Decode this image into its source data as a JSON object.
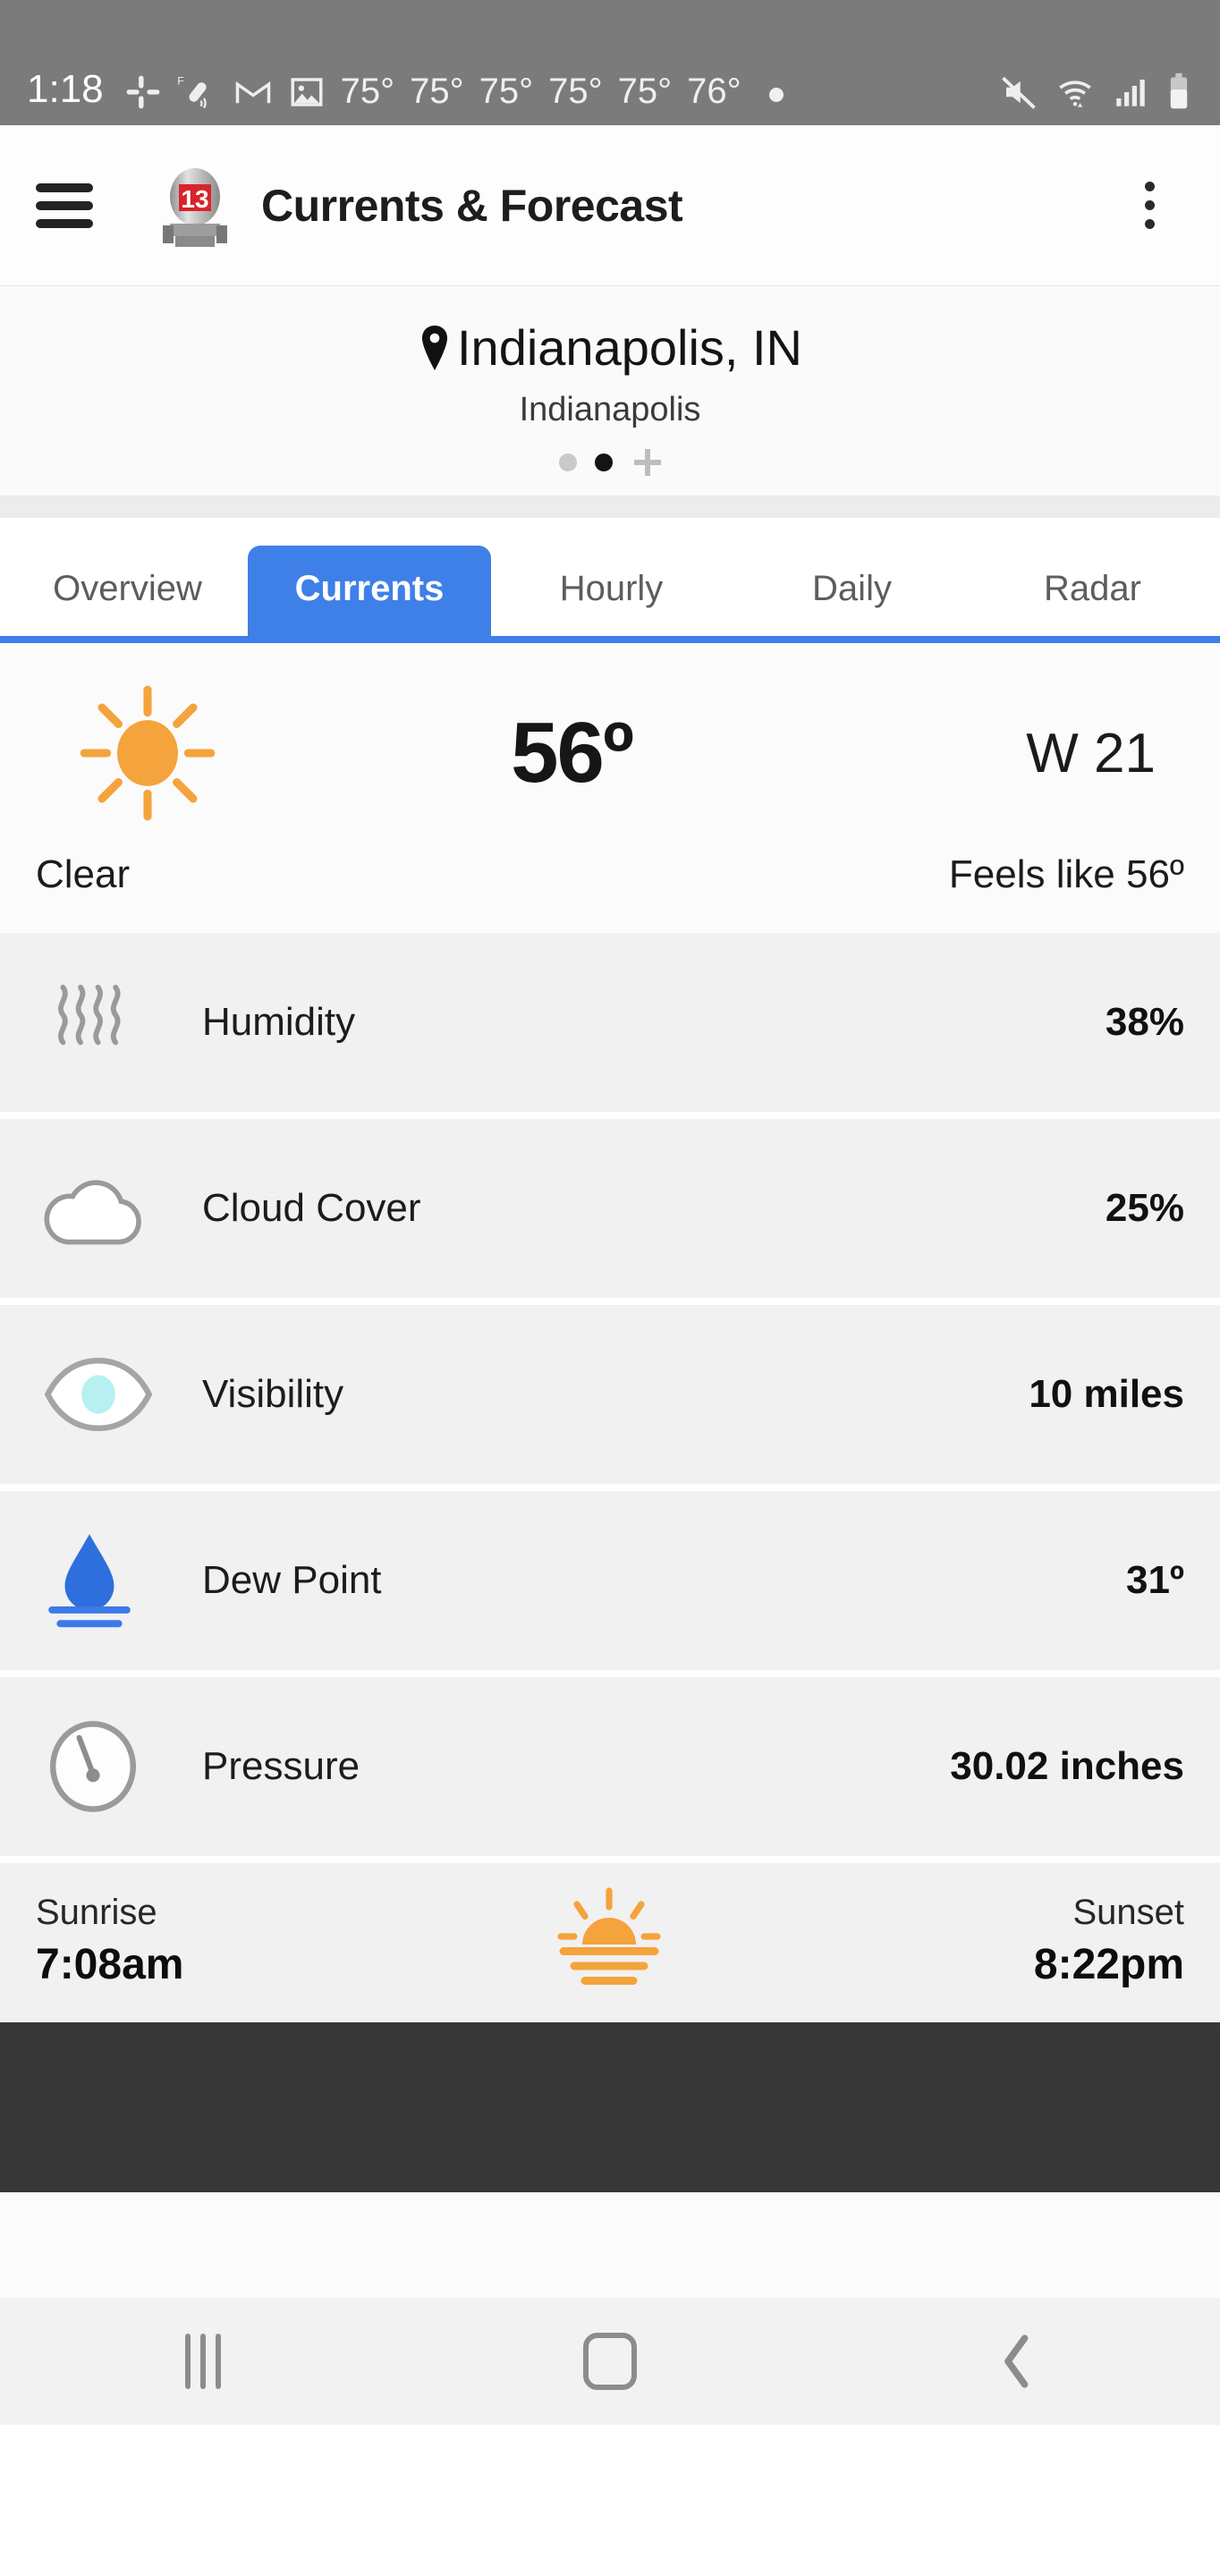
{
  "statusbar": {
    "time": "1:18",
    "icons_left": [
      "slack-icon",
      "sensor-cast-icon",
      "gmail-icon",
      "photo-icon"
    ],
    "temperatures": [
      "75°",
      "75°",
      "75°",
      "75°",
      "75°",
      "76°"
    ],
    "icons_right": [
      "mute-icon",
      "wifi-icon",
      "signal-icon",
      "battery-icon"
    ],
    "background": "#7b7b7b"
  },
  "appbar": {
    "menu_icon": "hamburger-icon",
    "logo": "channel-13-logo",
    "logo_number": "13",
    "title": "Currents & Forecast",
    "overflow_icon": "overflow-menu-icon"
  },
  "location": {
    "pin_icon": "location-pin-icon",
    "name": "Indianapolis, IN",
    "sub": "Indianapolis",
    "page_dots": [
      {
        "active": false
      },
      {
        "active": true
      }
    ],
    "add_label": "add-location-icon"
  },
  "tabs": [
    {
      "label": "Overview",
      "active": false
    },
    {
      "label": "Currents",
      "active": true
    },
    {
      "label": "Hourly",
      "active": false
    },
    {
      "label": "Daily",
      "active": false
    },
    {
      "label": "Radar",
      "active": false
    }
  ],
  "current": {
    "weather_icon": "sun-icon",
    "temperature": "56º",
    "wind": "W 21",
    "condition": "Clear",
    "feels_like": "Feels like 56º"
  },
  "details": [
    {
      "icon": "humidity-waves-icon",
      "label": "Humidity",
      "value": "38%"
    },
    {
      "icon": "cloud-icon",
      "label": "Cloud Cover",
      "value": "25%"
    },
    {
      "icon": "eye-icon",
      "label": "Visibility",
      "value": "10 miles"
    },
    {
      "icon": "water-drop-icon",
      "label": "Dew Point",
      "value": "31º"
    },
    {
      "icon": "gauge-icon",
      "label": "Pressure",
      "value": "30.02 inches"
    }
  ],
  "sun": {
    "sunrise_label": "Sunrise",
    "sunrise_time": "7:08am",
    "icon": "sunrise-sunset-icon",
    "sunset_label": "Sunset",
    "sunset_time": "8:22pm"
  },
  "navbar": {
    "recents": "recents-icon",
    "home": "home-icon",
    "back": "back-icon"
  },
  "colors": {
    "accent": "#3f7fe8",
    "sun": "#f5a33c",
    "row_bg": "#f1f1f1",
    "statusbar_bg": "#7b7b7b",
    "ad_bg": "#373737"
  }
}
